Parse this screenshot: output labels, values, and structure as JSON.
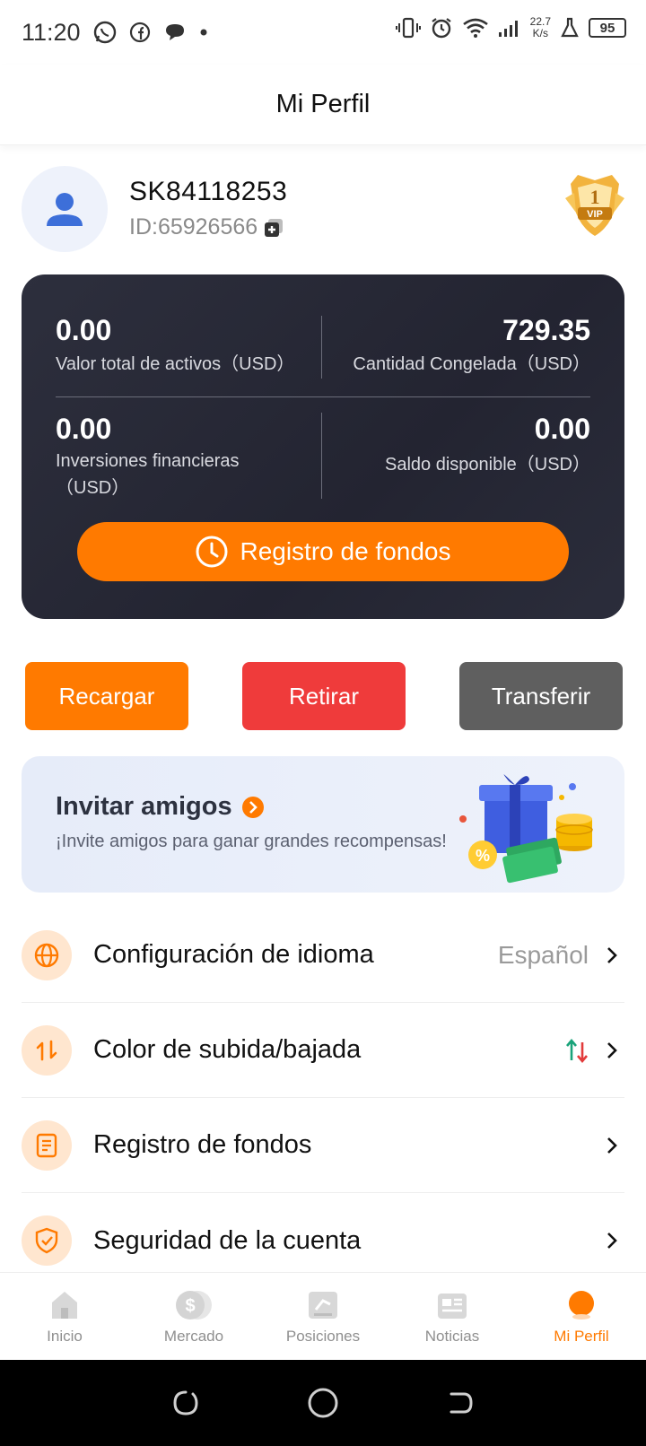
{
  "status_bar": {
    "time": "11:20",
    "net_speed_value": "22.7",
    "net_speed_unit": "K/s",
    "battery": "95"
  },
  "header": {
    "title": "Mi Perfil"
  },
  "profile": {
    "username": "SK84118253",
    "user_id": "ID:65926566",
    "vip_level": "1",
    "vip_text": "VIP"
  },
  "assets": {
    "total_value": "0.00",
    "total_label": "Valor total de activos（USD）",
    "frozen_value": "729.35",
    "frozen_label": "Cantidad Congelada（USD）",
    "investments_value": "0.00",
    "investments_label": "Inversiones financieras（USD）",
    "available_value": "0.00",
    "available_label": "Saldo disponible（USD）",
    "funds_button": "Registro de fondos"
  },
  "actions": {
    "recharge": "Recargar",
    "withdraw": "Retirar",
    "transfer": "Transferir"
  },
  "invite": {
    "title": "Invitar amigos",
    "subtitle": "¡Invite amigos para ganar grandes recompensas!"
  },
  "settings": {
    "language_label": "Configuración de idioma",
    "language_value": "Español",
    "color_label": "Color de subida/bajada",
    "funds_label": "Registro de fondos",
    "security_label": "Seguridad de la cuenta"
  },
  "bottom_nav": {
    "home": "Inicio",
    "market": "Mercado",
    "positions": "Posiciones",
    "news": "Noticias",
    "profile": "Mi Perfil"
  },
  "colors": {
    "accent": "#ff7a00",
    "withdraw": "#ef3b3b",
    "transfer": "#5f5f5f",
    "card_bg": "#282a37",
    "up_color": "#1aa37a",
    "down_color": "#e23b3b"
  }
}
